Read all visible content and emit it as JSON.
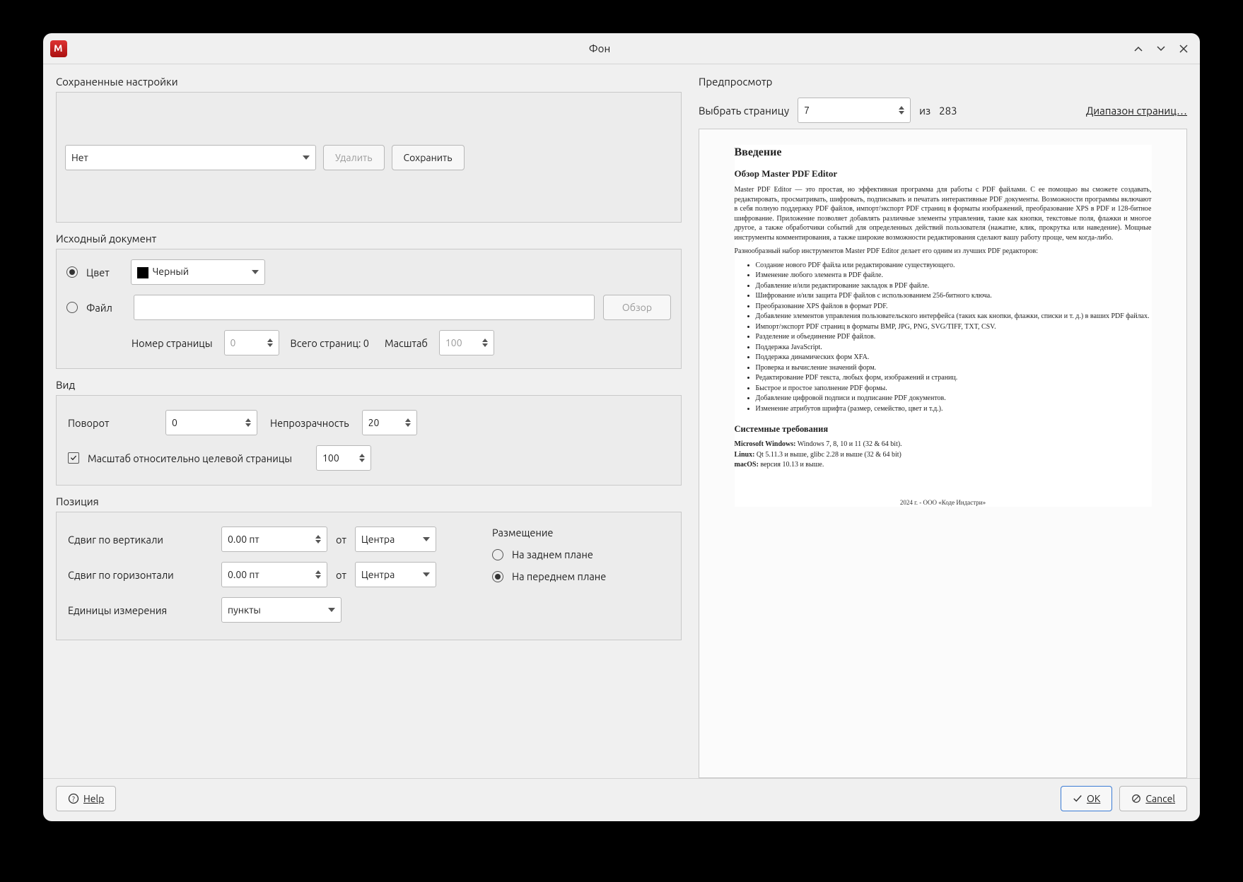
{
  "window": {
    "title": "Фон"
  },
  "saved": {
    "section": "Сохраненные настройки",
    "preset_value": "Нет",
    "delete": "Удалить",
    "save": "Сохранить"
  },
  "source": {
    "section": "Исходный документ",
    "color_label": "Цвет",
    "color_value": "Черный",
    "file_label": "Файл",
    "file_value": "",
    "browse": "Обзор",
    "page_number_label": "Номер страницы",
    "page_number_value": "0",
    "total_pages_label": "Всего страниц: 0",
    "scale_label": "Масштаб",
    "scale_value": "100"
  },
  "view": {
    "section": "Вид",
    "rotate_label": "Поворот",
    "rotate_value": "0",
    "opacity_label": "Непрозрачность",
    "opacity_value": "20",
    "scale_rel_label": "Масштаб относительно целевой страницы",
    "scale_rel_value": "100"
  },
  "position": {
    "section": "Позиция",
    "vshift_label": "Сдвиг по вертикали",
    "vshift_value": "0.00 пт",
    "hshift_label": "Сдвиг по горизонтали",
    "hshift_value": "0.00 пт",
    "from_label": "от",
    "from_value": "Центра",
    "units_label": "Единицы измерения",
    "units_value": "пункты",
    "placement_label": "Размещение",
    "behind_label": "На заднем плане",
    "front_label": "На переднем плане"
  },
  "preview": {
    "section": "Предпросмотр",
    "select_page_label": "Выбрать страницу",
    "page_value": "7",
    "of_label": "из",
    "total": "283",
    "range_link": "Диапазон страниц…"
  },
  "doc": {
    "h1": "Введение",
    "h2": "Обзор Master PDF Editor",
    "p1": "Master PDF Editor — это простая, но эффективная программа для работы с PDF файлами. С ее помощью вы сможете создавать, редактировать, просматривать, шифровать, подписывать и печатать интерактивные PDF документы. Возможности программы включают в себя полную поддержку PDF файлов, импорт/экспорт PDF страниц в форматы изображений, преобразование XPS в PDF и 128-битное шифрование. Приложение позволяет добавлять различные элементы управления, такие как кнопки, текстовые поля, флажки и многое другое, а также обработчики событий для определенных действий пользователя (нажатие, клик, прокрутка или наведение). Мощные инструменты комментирования, а также широкие возможности редактирования сделают вашу работу проще, чем когда-либо.",
    "p2": "Разнообразный набор инструментов Master PDF Editor делает его одним из лучших PDF редакторов:",
    "bullets": [
      "Создание нового PDF файла или редактирование существующего.",
      "Изменение любого элемента в PDF файле.",
      "Добавление и/или редактирование закладок в PDF файле.",
      "Шифрование и/или защита PDF файлов с использованием 256-битного ключа.",
      "Преобразование XPS файлов в формат PDF.",
      "Добавление элементов управления пользовательского интерфейса (таких как кнопки, флажки, списки и т. д.) в ваших PDF файлах.",
      "Импорт/экспорт PDF страниц в форматы BMP, JPG, PNG, SVG/TIFF, TXT, CSV.",
      "Разделение и объединение PDF файлов.",
      "Поддержка JavaScript.",
      "Поддержка динамических форм XFA.",
      "Проверка и вычисление значений форм.",
      "Редактирование PDF текста, любых форм, изображений и страниц.",
      "Быстрое и простое заполнение PDF формы.",
      "Добавление цифровой подписи и подписание PDF документов.",
      "Изменение атрибутов шрифта (размер, семейство, цвет и т.д.)."
    ],
    "h3": "Системные требования",
    "sys1a": "Microsoft Windows:",
    "sys1b": " Windows 7, 8, 10 и 11 (32 & 64 bit).",
    "sys2a": "Linux:",
    "sys2b": " Qt 5.11.3 и выше, glibc 2.28 и выше (32 & 64 bit)",
    "sys3a": "macOS:",
    "sys3b": " версия 10.13 и выше.",
    "footer": "2024 г. - ООО «Коде Индастри»"
  },
  "footer": {
    "help": "Help",
    "ok": "OK",
    "cancel": "Cancel"
  }
}
